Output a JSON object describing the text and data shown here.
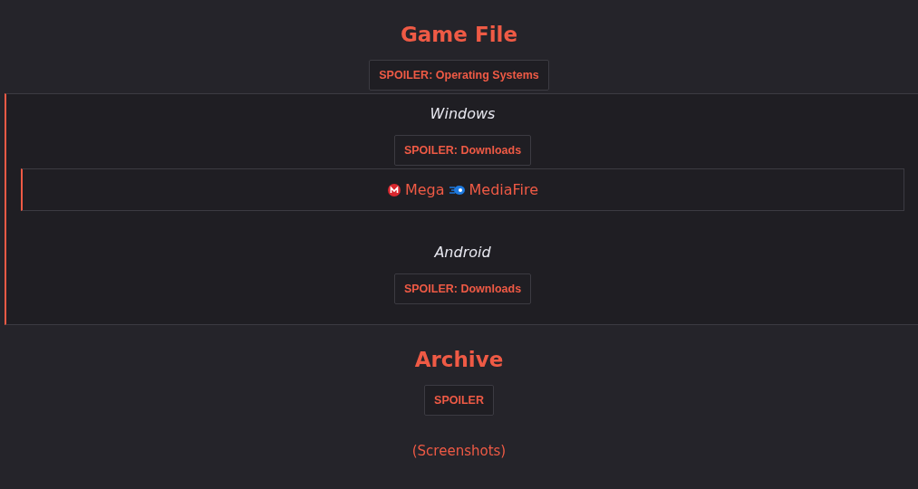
{
  "sections": [
    {
      "heading": "Game File",
      "spoiler": {
        "label": "SPOILER: Operating Systems",
        "groups": [
          {
            "title": "Windows",
            "spoiler": {
              "label": "SPOILER: Downloads",
              "links": [
                {
                  "kind": "mega",
                  "label": "Mega"
                },
                {
                  "kind": "mediafire",
                  "label": "MediaFire"
                }
              ]
            }
          },
          {
            "title": "Android",
            "spoiler": {
              "label": "SPOILER: Downloads"
            }
          }
        ]
      }
    },
    {
      "heading": "Archive",
      "spoiler": {
        "label": "SPOILER"
      }
    }
  ],
  "footer_link": "(Screenshots)"
}
